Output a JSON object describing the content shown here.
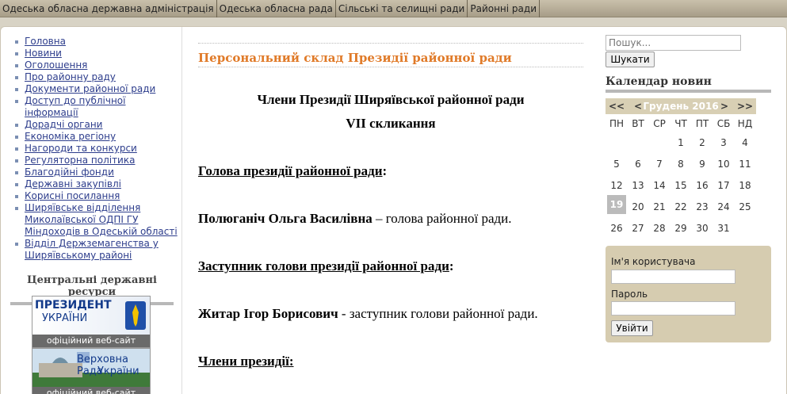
{
  "topnav": [
    "Одеська обласна державна адміністрація",
    "Одеська обласна рада",
    "Сільські та селищні ради",
    "Районні ради"
  ],
  "leftnav": [
    "Головна",
    "Новини",
    "Оголошення",
    "Про районну раду",
    "Документи районної ради",
    "Доступ до публічної інформації",
    "Дорадчі органи",
    "Економіка регіону",
    "Нагороди та конкурси",
    "Регуляторна політика",
    "Благодійні фонди",
    "Державні закупівлі",
    "Корисні посилання",
    "Ширяївське відділення Миколаївської ОДПІ ГУ Міндоходів в Одеській області",
    "Відділ Держземагенства у Ширяївському районі"
  ],
  "resources": {
    "title": "Центральні державні ресурси",
    "banners": [
      {
        "line1": "ПРЕЗИДЕНТ",
        "line2": "УКРАЇНИ",
        "caption": "офіційний веб-сайт"
      },
      {
        "line1": "Верховна Рада",
        "line2": "України",
        "caption": "офіційний веб-сайт"
      }
    ]
  },
  "main": {
    "title": "Персональний склад Президії районної ради",
    "heading1": "Члени Президії Ширяївської районної ради",
    "heading2": "VII скликання",
    "head_label": "Голова президії районної ради",
    "head_name": "Полюганіч Ольга Василівна",
    "head_role": " – голова районної ради.",
    "deputy_label": "Заступник голови президії районної ради",
    "deputy_name": "Житар Ігор Борисович",
    "deputy_role": " - заступник голови районної ради.",
    "members_label": "Члени президії:"
  },
  "search": {
    "placeholder": "Пошук...",
    "button": "Шукати"
  },
  "calendar": {
    "title": "Календар новин",
    "prev_year": "<<",
    "prev_month": "<",
    "month": "Грудень 2016",
    "next_month": ">",
    "next_year": ">>",
    "weekdays": [
      "ПН",
      "ВТ",
      "СР",
      "ЧТ",
      "ПТ",
      "СБ",
      "НД"
    ],
    "weeks": [
      [
        "",
        "",
        "",
        "1",
        "2",
        "3",
        "4"
      ],
      [
        "5",
        "6",
        "7",
        "8",
        "9",
        "10",
        "11"
      ],
      [
        "12",
        "13",
        "14",
        "15",
        "16",
        "17",
        "18"
      ],
      [
        "19",
        "20",
        "21",
        "22",
        "23",
        "24",
        "25"
      ],
      [
        "26",
        "27",
        "28",
        "29",
        "30",
        "31",
        ""
      ]
    ],
    "today": "19"
  },
  "login": {
    "username_label": "Ім'я користувача",
    "password_label": "Пароль",
    "button": "Увійти"
  },
  "colors": {
    "accent": "#e07a28",
    "link": "#2d3d8c",
    "panel": "#d6ccb0"
  }
}
